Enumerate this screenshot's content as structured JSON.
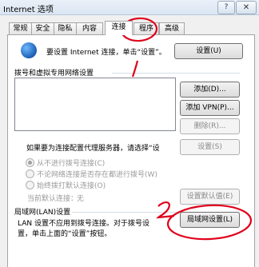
{
  "window": {
    "title": "Internet 选项",
    "help": "?",
    "close": "✕"
  },
  "tabs": [
    "常规",
    "安全",
    "隐私",
    "内容",
    "连接",
    "程序",
    "高级"
  ],
  "setup": {
    "text": "要设置 Internet 连接，单击“设置”。",
    "button": "设置(U)"
  },
  "dialup": {
    "heading": "拨号和虚拟专用网络设置",
    "add": "添加(D)...",
    "add_vpn": "添加 VPN(P)...",
    "remove": "删除(R)...",
    "proxy_text": "如果要为连接配置代理服务器，请选择“设",
    "settings": "设置(S)",
    "radios": [
      "从不进行拨号连接(C)",
      "不论网络连接是否存在都进行拨号(W)",
      "始终拨打默认连接(O)"
    ],
    "current_default": "当前默认连接：",
    "current_default_value": "无",
    "set_default": "设置默认值(E)"
  },
  "lan": {
    "heading": "局域网(LAN)设置",
    "desc_line1": "LAN 设置不应用到拨号连接。对于拨号设",
    "desc_line2": "置，单击上面的“设置”按钮。",
    "button": "局域网设置(L)"
  },
  "annotations": {
    "mark1": "1",
    "mark2": "2",
    "color": "#e0001a"
  },
  "icons": {
    "globe": "network-globe-icon"
  }
}
